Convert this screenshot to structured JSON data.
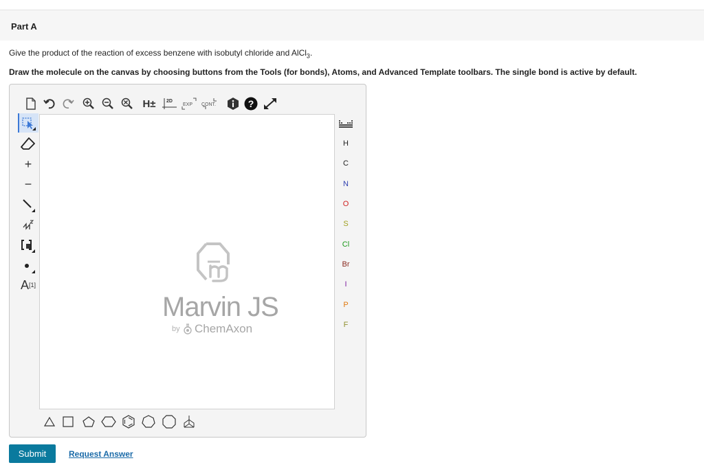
{
  "part": {
    "title": "Part A"
  },
  "question": {
    "text_before": "Give the product of the reaction of excess benzene with isobutyl chloride and AlCl",
    "subscript": "3",
    "text_after": "."
  },
  "instruction": "Draw the molecule on the canvas by choosing buttons from the Tools (for bonds), Atoms, and Advanced Template toolbars. The single bond is active by default.",
  "editor": {
    "top_toolbar": [
      {
        "name": "new-document-icon"
      },
      {
        "name": "undo-icon"
      },
      {
        "name": "redo-icon"
      },
      {
        "name": "zoom-in-icon"
      },
      {
        "name": "zoom-out-icon"
      },
      {
        "name": "zoom-fit-icon"
      },
      {
        "name": "explicit-hydrogens-button",
        "label": "H±"
      },
      {
        "name": "clean-2d-icon",
        "label": "2D"
      },
      {
        "name": "expand-group-icon",
        "label": "EXP"
      },
      {
        "name": "contract-group-icon",
        "label": "CONT."
      },
      {
        "name": "info-icon"
      },
      {
        "name": "help-icon"
      },
      {
        "name": "fullscreen-icon"
      }
    ],
    "left_toolbar": [
      {
        "name": "select-icon"
      },
      {
        "name": "erase-icon"
      },
      {
        "name": "increase-charge-icon",
        "label": "+"
      },
      {
        "name": "decrease-charge-icon",
        "label": "−"
      },
      {
        "name": "single-bond-icon"
      },
      {
        "name": "chain-icon"
      },
      {
        "name": "bracket-icon"
      },
      {
        "name": "radical-icon"
      },
      {
        "name": "atom-mapping-icon",
        "label": "A",
        "sup": "[1]"
      }
    ],
    "atoms": [
      {
        "symbol": "H",
        "color": "#333333"
      },
      {
        "symbol": "C",
        "color": "#333333"
      },
      {
        "symbol": "N",
        "color": "#3040b0"
      },
      {
        "symbol": "O",
        "color": "#d02020"
      },
      {
        "symbol": "S",
        "color": "#a0a020"
      },
      {
        "symbol": "Cl",
        "color": "#1a9a1a"
      },
      {
        "symbol": "Br",
        "color": "#8a2a20"
      },
      {
        "symbol": "I",
        "color": "#8020a0"
      },
      {
        "symbol": "P",
        "color": "#e07a10"
      },
      {
        "symbol": "F",
        "color": "#909030"
      }
    ],
    "watermark": {
      "title": "Marvin JS",
      "by": "by",
      "company": "ChemAxon"
    },
    "templates": [
      {
        "name": "cyclopropane-icon"
      },
      {
        "name": "cyclobutane-icon"
      },
      {
        "name": "cyclopentane-icon"
      },
      {
        "name": "cyclohexane-icon"
      },
      {
        "name": "benzene-icon"
      },
      {
        "name": "cycloheptane-icon"
      },
      {
        "name": "cyclooctane-icon"
      },
      {
        "name": "template-library-icon"
      }
    ]
  },
  "actions": {
    "submit": "Submit",
    "request_answer": "Request Answer"
  }
}
